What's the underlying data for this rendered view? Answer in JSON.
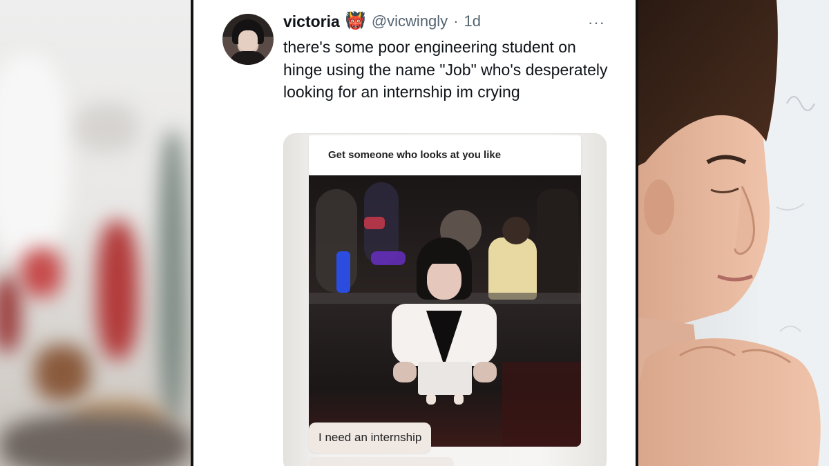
{
  "tweet": {
    "display_name": "victoria",
    "name_emoji": "👹",
    "handle": "@vicwingly",
    "separator": "·",
    "time_ago": "1d",
    "more_label": "···",
    "text": "there's some poor engineering student on hinge using the name \"Job\" who's desperately looking for an internship im crying"
  },
  "hinge_card": {
    "prompt": "Get someone who looks at you like",
    "reply": "I need an internship"
  },
  "colors": {
    "text_primary": "#0f1419",
    "text_secondary": "#536471",
    "panel_bg": "#ffffff",
    "divider": "#111111"
  }
}
